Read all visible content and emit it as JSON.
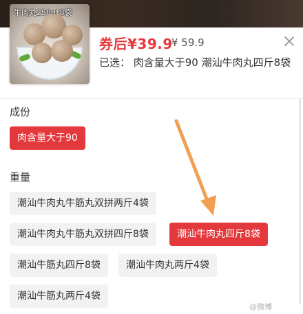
{
  "product": {
    "thumbnail_label": "牛肉丸250g*8袋",
    "price_now": "券后¥39.9",
    "price_old": "¥ 59.9",
    "selected_text": "已选：  肉含量大于90 潮汕牛肉丸四斤8袋"
  },
  "sections": {
    "ingredient": {
      "title": "成份",
      "options": [
        "肉含量大于90"
      ]
    },
    "weight": {
      "title": "重量",
      "options": [
        "潮汕牛肉丸牛筋丸双拼两斤4袋",
        "潮汕牛肉丸牛筋丸双拼四斤8袋",
        "潮汕牛肉丸四斤8袋",
        "潮汕牛筋丸四斤8袋",
        "潮汕牛肉丸两斤4袋",
        "潮汕牛筋丸两斤4袋"
      ]
    }
  },
  "watermark": "@微博",
  "colors": {
    "accent": "#e4393c",
    "arrow": "#f0a050"
  },
  "icons": {
    "close": "close-icon",
    "annotation": "arrow-icon"
  }
}
